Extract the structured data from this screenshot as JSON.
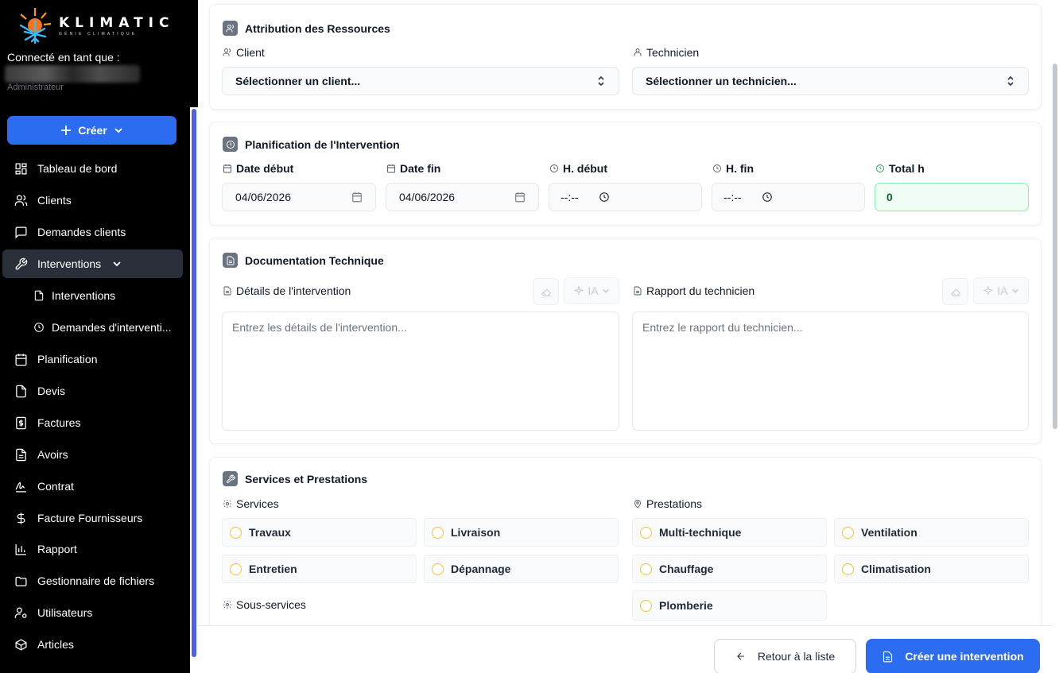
{
  "brand": {
    "name": "KLIMATIC",
    "tagline": "GÉNIE CLIMATIQUE"
  },
  "session": {
    "connected_as": "Connecté en tant que :",
    "role": "Administrateur"
  },
  "sidebar": {
    "create_label": "Créer",
    "items": [
      {
        "label": "Tableau de bord",
        "icon": "dashboard-icon"
      },
      {
        "label": "Clients",
        "icon": "users-icon"
      },
      {
        "label": "Demandes clients",
        "icon": "message-icon"
      },
      {
        "label": "Interventions",
        "icon": "wrench-icon",
        "active": true,
        "expanded": true
      },
      {
        "label": "Interventions",
        "icon": "file-icon",
        "sub": true
      },
      {
        "label": "Demandes d'interventi...",
        "icon": "clock-icon",
        "sub": true
      },
      {
        "label": "Planification",
        "icon": "calendar-icon"
      },
      {
        "label": "Devis",
        "icon": "file-icon"
      },
      {
        "label": "Factures",
        "icon": "invoice-icon"
      },
      {
        "label": "Avoirs",
        "icon": "file-text-icon"
      },
      {
        "label": "Contrat",
        "icon": "signature-icon"
      },
      {
        "label": "Facture Fournisseurs",
        "icon": "dollar-icon"
      },
      {
        "label": "Rapport",
        "icon": "bar-chart-icon"
      },
      {
        "label": "Gestionnaire de fichiers",
        "icon": "folder-icon"
      },
      {
        "label": "Utilisateurs",
        "icon": "user-cog-icon"
      },
      {
        "label": "Articles",
        "icon": "package-icon"
      }
    ]
  },
  "resources": {
    "title": "Attribution des Ressources",
    "client_label": "Client",
    "client_placeholder": "Sélectionner un client...",
    "tech_label": "Technicien",
    "tech_placeholder": "Sélectionner un technicien..."
  },
  "planning": {
    "title": "Planification de l'Intervention",
    "date_start_label": "Date début",
    "date_start": "04/06/2026",
    "date_end_label": "Date fin",
    "date_end": "04/06/2026",
    "hour_start_label": "H. début",
    "hour_start": "--:--",
    "hour_end_label": "H. fin",
    "hour_end": "--:--",
    "total_label": "Total h",
    "total": "0"
  },
  "documentation": {
    "title": "Documentation Technique",
    "details_label": "Détails de l'intervention",
    "details_placeholder": "Entrez les détails de l'intervention...",
    "report_label": "Rapport du technicien",
    "report_placeholder": "Entrez le rapport du technicien...",
    "ai_label": "IA"
  },
  "services": {
    "title": "Services et Prestations",
    "services_label": "Services",
    "services": [
      "Travaux",
      "Livraison",
      "Entretien",
      "Dépannage"
    ],
    "prestations_label": "Prestations",
    "prestations": [
      "Multi-technique",
      "Ventilation",
      "Chauffage",
      "Climatisation",
      "Plomberie"
    ],
    "subservices_label": "Sous-services"
  },
  "footer": {
    "back_label": "Retour à la liste",
    "create_label": "Créer une intervention"
  },
  "colors": {
    "primary": "#2b6cf0",
    "sidebar_bg": "#000000",
    "accent_scroll": "#4f5fe8",
    "checkbox_ring": "#fbbf24",
    "total_green": "#16a34a"
  }
}
